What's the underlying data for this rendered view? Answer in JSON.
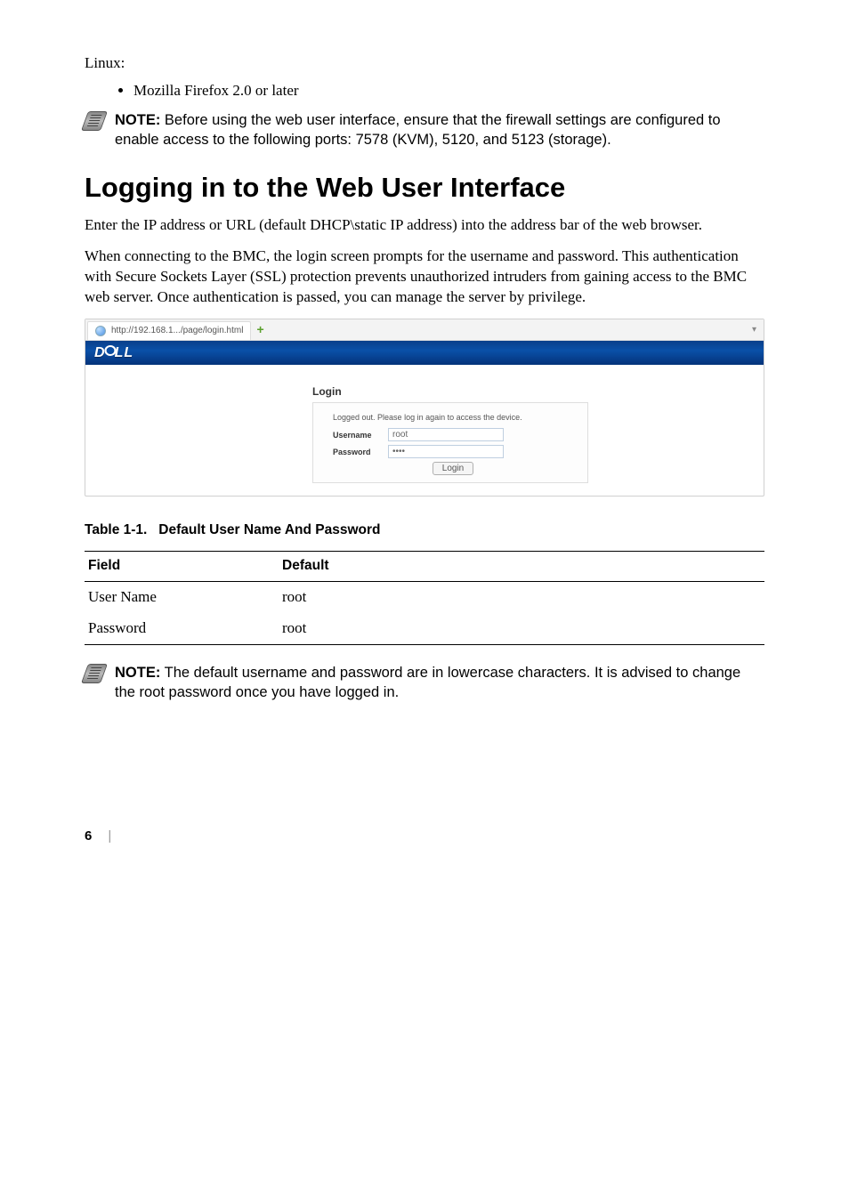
{
  "intro": {
    "os_label": "Linux:",
    "bullet": "Mozilla Firefox 2.0 or later"
  },
  "note1": {
    "bold": "NOTE:",
    "text": " Before using the web user interface, ensure that the firewall settings are configured to enable access to the following ports: 7578 (KVM), 5120, and 5123 (storage)."
  },
  "heading": "Logging in to the Web User Interface",
  "para1": "Enter the IP address or URL (default DHCP\\static IP address) into the address bar of the web browser.",
  "para2": "When connecting to the BMC, the login screen prompts for the username and password. This authentication with Secure Sockets Layer (SSL) protection prevents unauthorized intruders from gaining access to the BMC web server. Once authentication is passed, you can manage the server by privilege.",
  "screenshot": {
    "tab_url": "http://192.168.1.../page/login.html",
    "tab_plus": "+",
    "dropdown_glyph": "▾",
    "brand": "D  LL",
    "login_title": "Login",
    "login_msg": "Logged out. Please log in again to access the device.",
    "username_label": "Username",
    "username_value": "root",
    "password_label": "Password",
    "password_value": "••••",
    "login_button": "Login"
  },
  "table": {
    "caption_prefix": "Table 1-1.",
    "caption": "Default User Name And Password",
    "head_field": "Field",
    "head_default": "Default",
    "rows": [
      {
        "field": "User Name",
        "default": "root"
      },
      {
        "field": "Password",
        "default": "root"
      }
    ]
  },
  "note2": {
    "bold": "NOTE:",
    "text": " The default username and password are in lowercase characters. It is advised to change the root password once you have logged in."
  },
  "page_number": "6"
}
